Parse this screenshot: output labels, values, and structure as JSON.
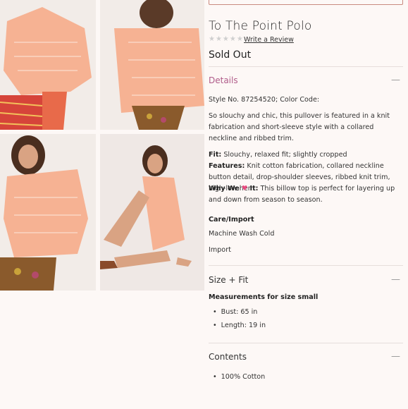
{
  "product": {
    "title": "To The Point Polo",
    "stars": "★★★★★",
    "review_link": "Write a Review",
    "status": "Sold Out"
  },
  "details": {
    "heading": "Details",
    "style_line": "Style No. 87254520; Color Code:",
    "description": "So slouchy and chic, this pullover is featured in a knit fabrication and short-sleeve style with a collared neckline and ribbed trim.",
    "fit_label": "Fit:",
    "fit_text": "Slouchy, relaxed fit; slightly cropped",
    "features_label": "Features:",
    "features_text": "Knit cotton fabrication, collared neckline button detail, drop-shoulder sleeves, ribbed knit trim, high-low hem",
    "why_label_a": "Why We",
    "why_label_b": "It:",
    "heart": "♥",
    "why_text": "This billow top is perfect for layering up and down from season to season.",
    "care_heading": "Care/Import",
    "care_1": "Machine Wash Cold",
    "care_2": "Import"
  },
  "size_fit": {
    "heading": "Size + Fit",
    "measure_heading": "Measurements for size small",
    "bullets": [
      "Bust: 65 in",
      "Length: 19 in"
    ]
  },
  "contents": {
    "heading": "Contents",
    "bullets": [
      "100% Cotton"
    ]
  },
  "icons": {
    "collapse": "minus-icon"
  },
  "colors": {
    "accent": "#b05c8a",
    "sweater": "#f7b59a",
    "background": "#fdf8f6"
  }
}
